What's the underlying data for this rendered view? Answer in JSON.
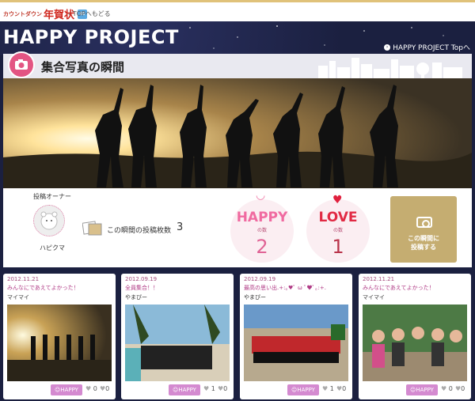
{
  "topbar": {
    "brand_small": "カウントダウン",
    "brand_main": "年賀状",
    "back_label": "TOPへもどる"
  },
  "header": {
    "title": "HAPPY PROJECT",
    "top_link": "HAPPY PROJECT Topへ"
  },
  "section": {
    "title": "集合写真の瞬間"
  },
  "owner": {
    "label": "投稿オーナー",
    "name": "ハピクマ"
  },
  "count": {
    "label": "この瞬間の投稿枚数",
    "value": "3"
  },
  "happy": {
    "label": "HAPPY",
    "sub": "の数",
    "value": "2"
  },
  "love": {
    "label": "LOVE",
    "sub": "の数",
    "value": "1"
  },
  "post_button": {
    "line1": "この瞬間に",
    "line2": "投稿する"
  },
  "cards": [
    {
      "date": "2012.11.21",
      "title": "みんなにであえてよかった！",
      "user": "マイマイ",
      "happy_btn": "HAPPY",
      "happy_count": "0",
      "love_count": "0"
    },
    {
      "date": "2012.09.19",
      "title": "全員集合！！",
      "user": "やまぴー",
      "happy_btn": "HAPPY",
      "happy_count": "1",
      "love_count": "0"
    },
    {
      "date": "2012.09.19",
      "title": "最高の思い出.+:｡♥ﾟ ω ﾟ♥ﾟ｡:+.",
      "user": "やまぴー",
      "happy_btn": "HAPPY",
      "happy_count": "1",
      "love_count": "0"
    },
    {
      "date": "2012.11.21",
      "title": "みんなにであえてよかった！",
      "user": "マイマイ",
      "happy_btn": "HAPPY",
      "happy_count": "0",
      "love_count": "0"
    }
  ],
  "colors": {
    "accent_pink": "#e35583",
    "gold": "#c5ad71",
    "navy": "#1b2040"
  }
}
